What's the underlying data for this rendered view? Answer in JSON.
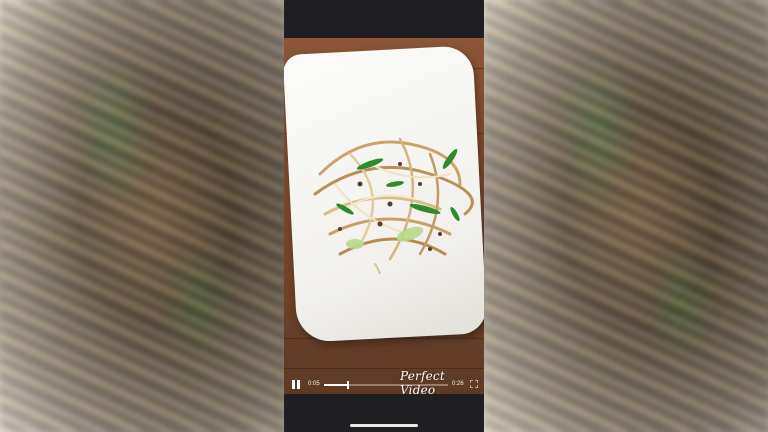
{
  "video": {
    "watermark": "Perfect Video",
    "current_time": "0:05",
    "total_time": "0:26",
    "progress": 0.19,
    "state": "playing"
  },
  "icons": {
    "play_pause": "pause-icon",
    "fullscreen": "fullscreen-icon"
  },
  "colors": {
    "video_bg": "#7a4a2e",
    "chrome": "#1f1f22",
    "control_fg": "#ffffff"
  }
}
